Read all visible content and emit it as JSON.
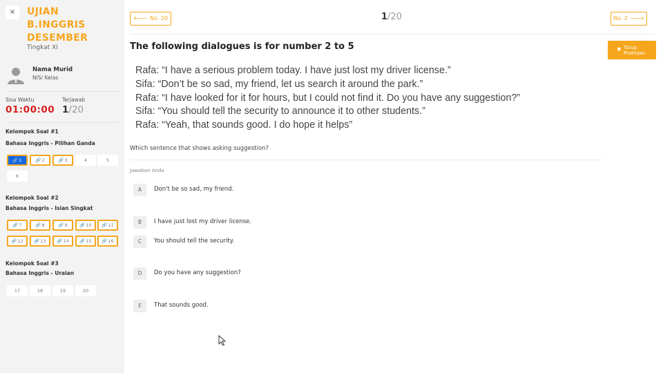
{
  "sidebar": {
    "close_icon": "×",
    "exam_title_lines": [
      "UJIAN",
      "B.INGGRIS",
      "DESEMBER"
    ],
    "exam_level": "Tingkat XI",
    "student_name": "Nama Murid",
    "student_nis": "NIS/ Kelas",
    "time_label": "Sisa Waktu",
    "time_value": "01:00:00",
    "answered_label": "Terjawab",
    "answered_count": "1",
    "answered_total": "/20",
    "groups": [
      {
        "title": "Kelompok Soal #1",
        "subtitle": "Bahasa Inggris - Pilihan Ganda",
        "questions": [
          {
            "num": "1",
            "state": "current"
          },
          {
            "num": "2",
            "state": "marked"
          },
          {
            "num": "3",
            "state": "marked"
          },
          {
            "num": "4",
            "state": "normal"
          },
          {
            "num": "5",
            "state": "normal"
          },
          {
            "num": "6",
            "state": "normal"
          }
        ]
      },
      {
        "title": "Kelompok Soal #2",
        "subtitle": "Bahasa Inggris - Isian Singkat",
        "questions": [
          {
            "num": "7",
            "state": "marked"
          },
          {
            "num": "8",
            "state": "marked"
          },
          {
            "num": "9",
            "state": "marked"
          },
          {
            "num": "10",
            "state": "marked"
          },
          {
            "num": "11",
            "state": "marked"
          },
          {
            "num": "12",
            "state": "marked"
          },
          {
            "num": "13",
            "state": "marked"
          },
          {
            "num": "14",
            "state": "marked"
          },
          {
            "num": "15",
            "state": "marked"
          },
          {
            "num": "16",
            "state": "marked"
          }
        ]
      },
      {
        "title": "Kelompok Soal #3",
        "subtitle": "Bahasa Inggris - Uraian",
        "questions": [
          {
            "num": "17",
            "state": "normal"
          },
          {
            "num": "18",
            "state": "normal"
          },
          {
            "num": "19",
            "state": "normal"
          },
          {
            "num": "20",
            "state": "normal"
          }
        ]
      }
    ]
  },
  "header": {
    "prev_label": "No. 20",
    "next_label": "No. 2",
    "current_page": "1",
    "total_pages": "/20",
    "close_preview_label": "Tutup Pratinjau"
  },
  "question": {
    "heading": "The following dialogues is for number 2 to 5",
    "dialogue": [
      "Rafa: “I have a serious problem today. I have just lost my driver license.”",
      "Sifa: “Don’t be so sad, my friend, let us search it around the park.”",
      "Rafa: “I have looked for it for hours, but I could not find it. Do you have any suggestion?”",
      "Sifa: “You should tell the security to announce it to other students.”",
      "Rafa: “Yeah, that sounds good. I do hope it helps”"
    ],
    "prompt": "Which sentence that shows asking suggestion?",
    "answer_label": "Jawaban Anda",
    "options": [
      {
        "letter": "A",
        "text": "Don't be so sad, my friend."
      },
      {
        "letter": "B",
        "text": "I have just lost my driver license."
      },
      {
        "letter": "C",
        "text": "You should tell the security."
      },
      {
        "letter": "D",
        "text": "Do you have any suggestion?"
      },
      {
        "letter": "E",
        "text": "That sounds good."
      }
    ]
  },
  "colors": {
    "accent": "#f5a61c",
    "current": "#1668e3",
    "timer": "#d61f1f",
    "sidebar_bg": "#f3f3f3"
  },
  "icons": {
    "close": "close-icon",
    "prev": "arrow-left-icon",
    "next": "arrow-right-icon",
    "question_link": "link-icon",
    "avatar": "user-avatar-icon"
  }
}
